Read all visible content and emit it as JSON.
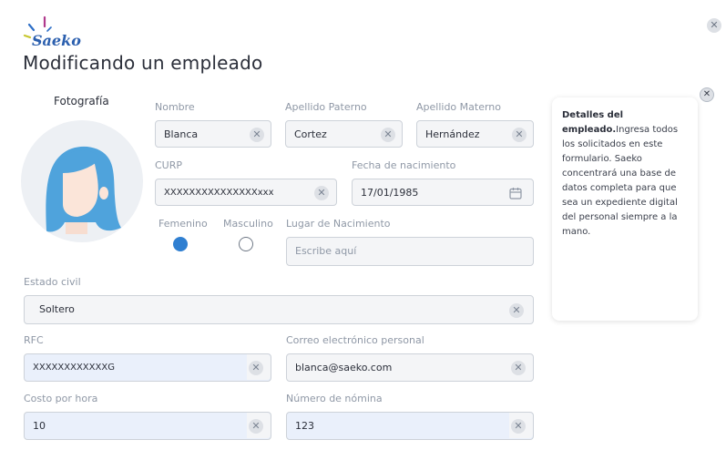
{
  "brand": {
    "logo_text": "Saeko"
  },
  "page_title": "Modificando un empleado",
  "photo": {
    "label": "Fotografía"
  },
  "fields": {
    "nombre": {
      "label": "Nombre",
      "value": "Blanca"
    },
    "apellido_paterno": {
      "label": "Apellido Paterno",
      "value": "Cortez"
    },
    "apellido_materno": {
      "label": "Apellido Materno",
      "value": "Hernández"
    },
    "curp": {
      "label": "CURP",
      "value": "XXXXXXXXXXXXXXXxxx"
    },
    "fecha_nacimiento": {
      "label": "Fecha de nacimiento",
      "value": "17/01/1985"
    },
    "lugar_nacimiento": {
      "label": "Lugar de Nacimiento",
      "placeholder": "Escribe aquí"
    },
    "estado_civil": {
      "label": "Estado civil",
      "value": "Soltero"
    },
    "rfc": {
      "label": "RFC",
      "value": "XXXXXXXXXXXXG"
    },
    "correo": {
      "label": "Correo electrónico personal",
      "value": "blanca@saeko.com"
    },
    "costo_hora": {
      "label": "Costo por hora",
      "value": "10"
    },
    "numero_nomina": {
      "label": "Número de nómina",
      "value": "123"
    }
  },
  "gender": {
    "female_label": "Femenino",
    "male_label": "Masculino",
    "selected": "Femenino"
  },
  "help_panel": {
    "title": "Detalles del empleado.",
    "body": "Ingresa todos los solicitados en este formulario. Saeko concentrará una base de datos completa para que sea un expediente digital del personal siempre a la mano."
  },
  "icons": {
    "close": "close-icon",
    "clear": "clear-icon",
    "calendar": "calendar-icon"
  },
  "colors": {
    "accent": "#2f7fd1",
    "hair": "#4fa3dc",
    "logo_blue": "#2b5fae",
    "field_bg": "#f4f5f7",
    "field_blue_bg": "#eaf0fb"
  }
}
